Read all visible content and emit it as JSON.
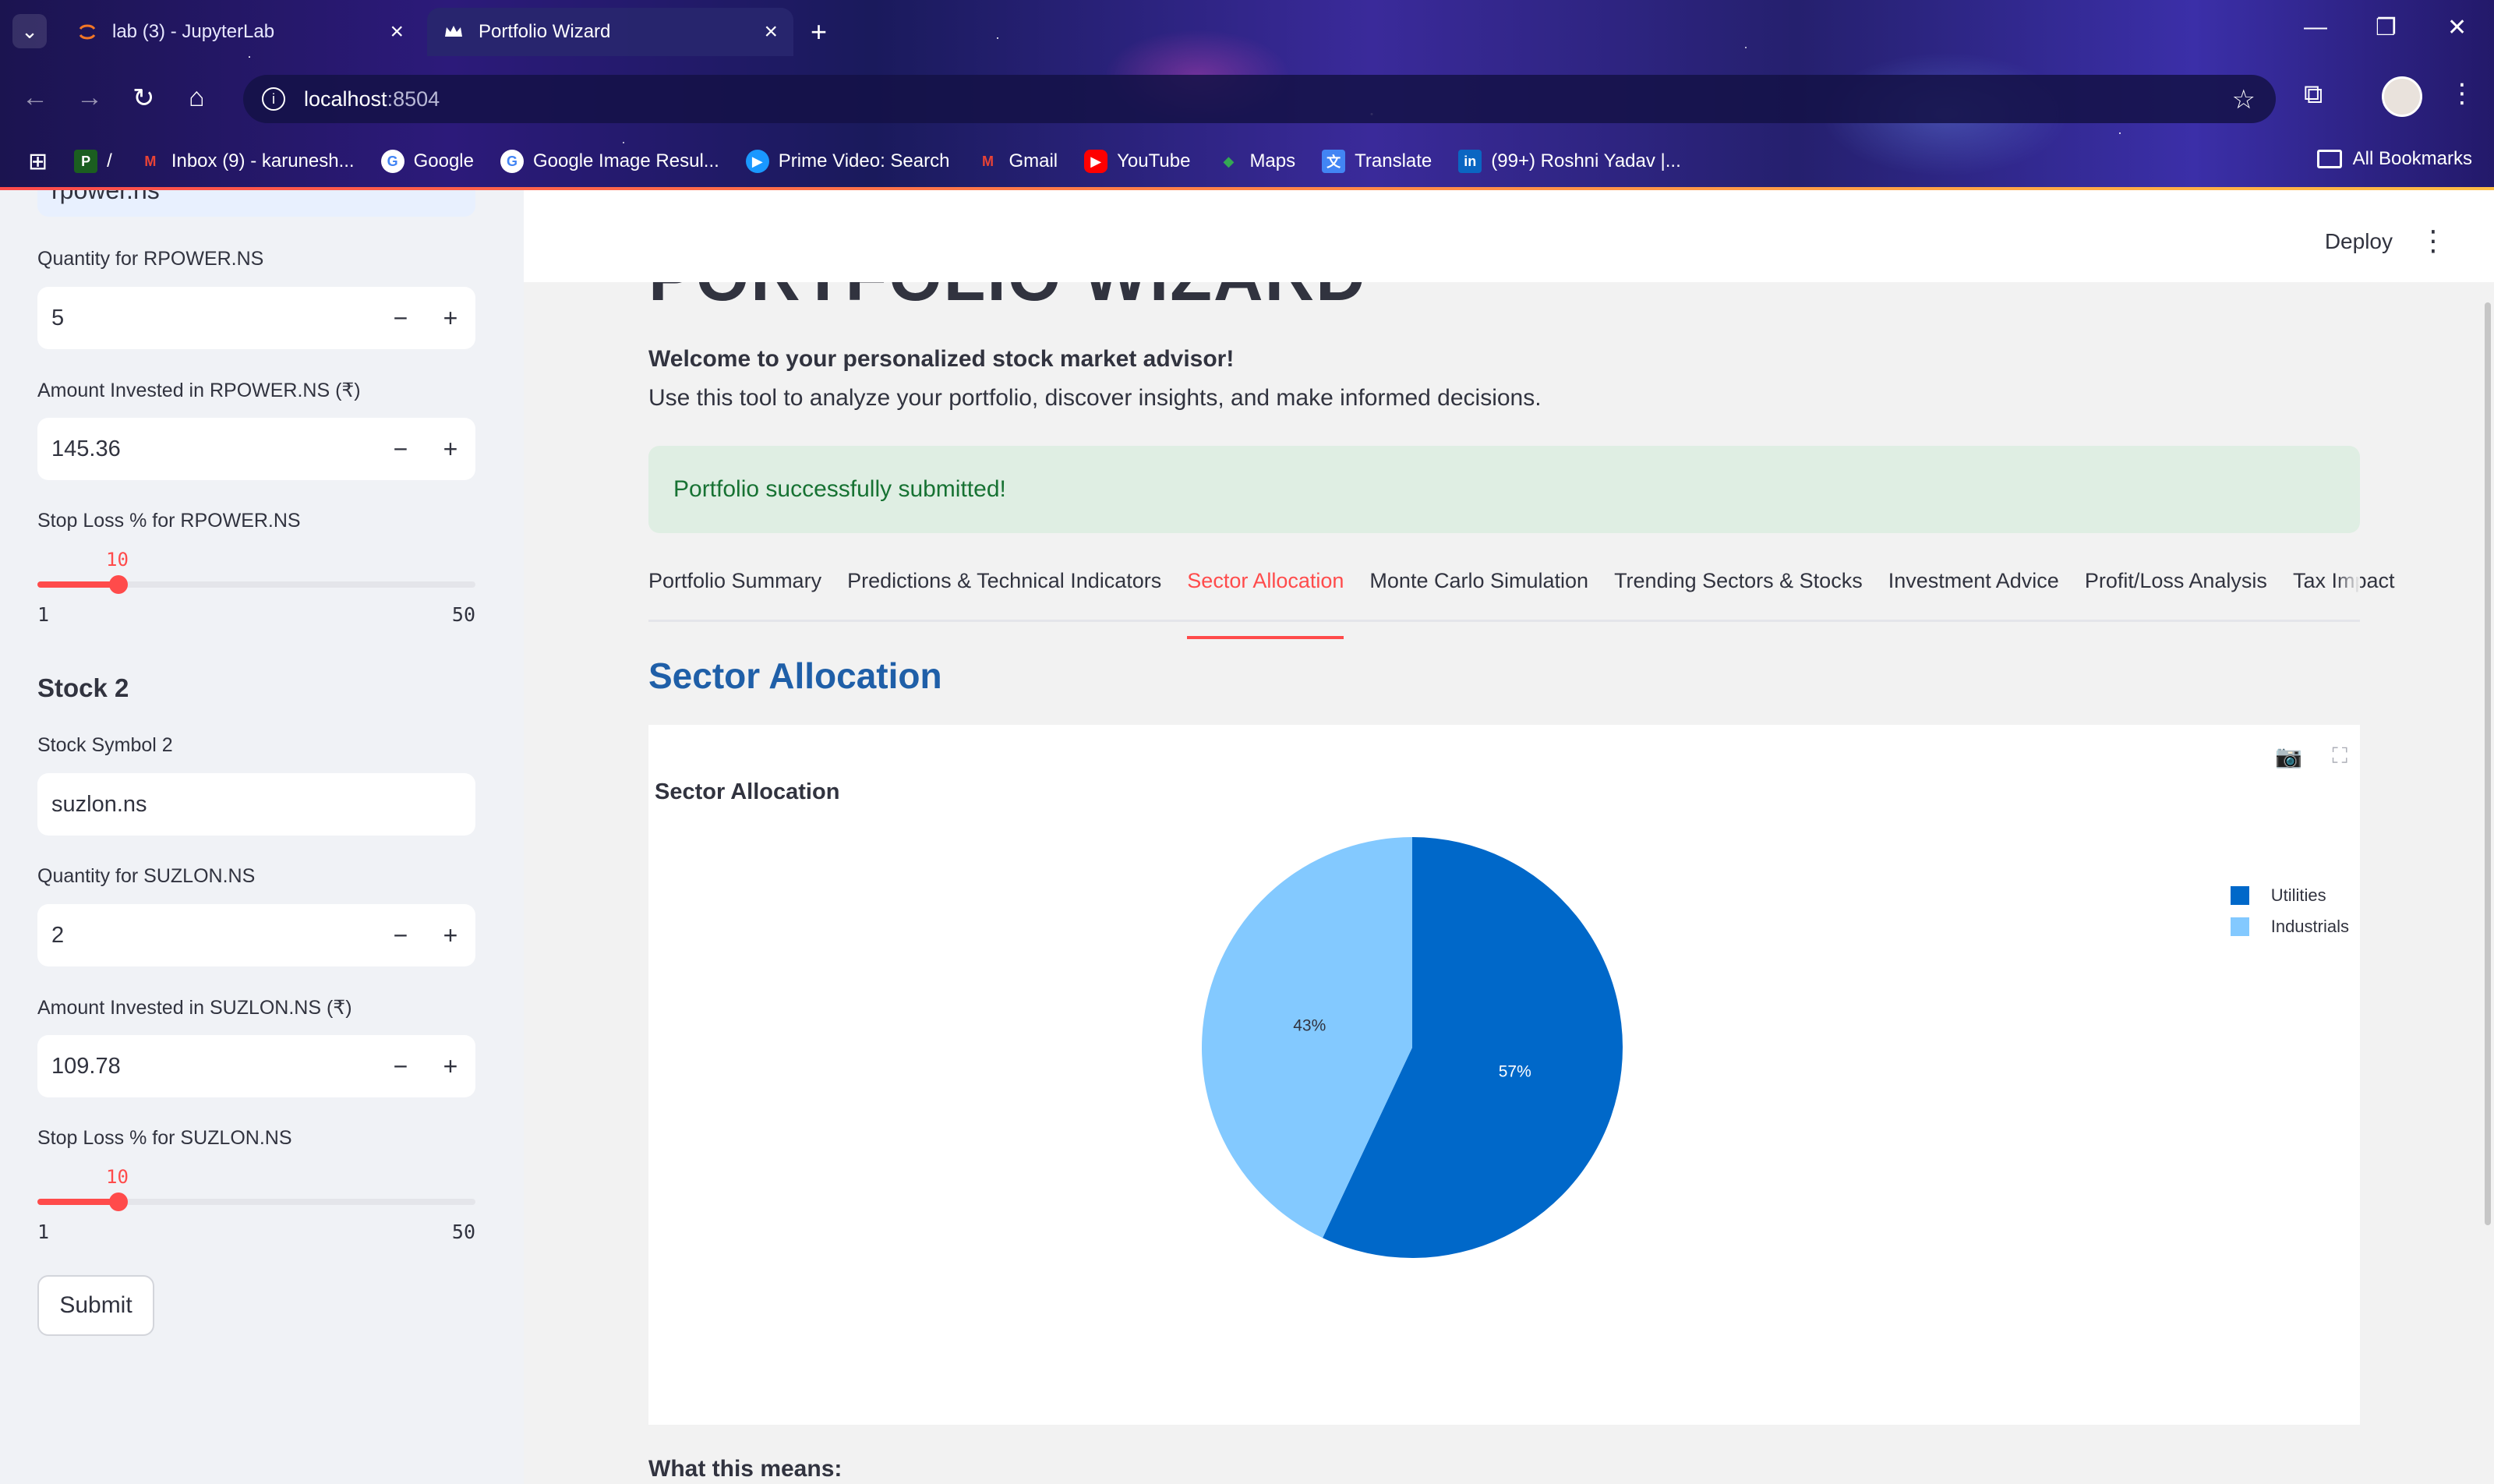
{
  "browser": {
    "tabs": [
      {
        "title": "lab (3) - JupyterLab",
        "active": false
      },
      {
        "title": "Portfolio Wizard",
        "active": true
      }
    ],
    "url_host": "localhost",
    "url_port": ":8504",
    "bookmarks": [
      {
        "label": "/",
        "icon": "bookmark-icon"
      },
      {
        "label": "Inbox (9) - karunesh...",
        "icon": "gmail-icon"
      },
      {
        "label": "Google",
        "icon": "google-icon"
      },
      {
        "label": "Google Image Resul...",
        "icon": "google-icon"
      },
      {
        "label": "Prime Video: Search",
        "icon": "prime-video-icon"
      },
      {
        "label": "Gmail",
        "icon": "gmail-icon"
      },
      {
        "label": "YouTube",
        "icon": "youtube-icon"
      },
      {
        "label": "Maps",
        "icon": "maps-icon"
      },
      {
        "label": "Translate",
        "icon": "translate-icon"
      },
      {
        "label": "(99+) Roshni Yadav |...",
        "icon": "linkedin-icon"
      }
    ],
    "all_bookmarks": "All Bookmarks"
  },
  "sidebar": {
    "cut_input_value": "rpower.ns",
    "stock1": {
      "quantity_label": "Quantity for RPOWER.NS",
      "quantity_value": "5",
      "amount_label": "Amount Invested in RPOWER.NS (₹)",
      "amount_value": "145.36",
      "stoploss_label": "Stop Loss % for RPOWER.NS",
      "stoploss_value": "10",
      "stoploss_min": "1",
      "stoploss_max": "50"
    },
    "stock2": {
      "heading": "Stock 2",
      "symbol_label": "Stock Symbol 2",
      "symbol_value": "suzlon.ns",
      "quantity_label": "Quantity for SUZLON.NS",
      "quantity_value": "2",
      "amount_label": "Amount Invested in SUZLON.NS (₹)",
      "amount_value": "109.78",
      "stoploss_label": "Stop Loss % for SUZLON.NS",
      "stoploss_value": "10",
      "stoploss_min": "1",
      "stoploss_max": "50"
    },
    "submit_label": "Submit",
    "minus": "−",
    "plus": "+"
  },
  "header": {
    "deploy_label": "Deploy"
  },
  "main": {
    "page_title": "PORTFOLIO WIZARD",
    "welcome_strong": "Welcome to your personalized stock market advisor!",
    "welcome_text": "Use this tool to analyze your portfolio, discover insights, and make informed decisions.",
    "success_message": "Portfolio successfully submitted!",
    "tabs": [
      {
        "label": "Portfolio Summary",
        "active": false
      },
      {
        "label": "Predictions & Technical Indicators",
        "active": false
      },
      {
        "label": "Sector Allocation",
        "active": true
      },
      {
        "label": "Monte Carlo Simulation",
        "active": false
      },
      {
        "label": "Trending Sectors & Stocks",
        "active": false
      },
      {
        "label": "Investment Advice",
        "active": false
      },
      {
        "label": "Profit/Loss Analysis",
        "active": false
      },
      {
        "label": "Tax Impact",
        "active": false
      }
    ],
    "section_heading": "Sector Allocation",
    "what_this_means": "What this means:"
  },
  "colors": {
    "accent": "#ff4b4b",
    "utilities": "#0068c9",
    "industrials": "#83c9ff",
    "heading_blue": "#1f5fa8"
  },
  "chart_data": {
    "type": "pie",
    "title": "Sector Allocation",
    "categories": [
      "Utilities",
      "Industrials"
    ],
    "values": [
      57,
      43
    ],
    "labels": [
      "57%",
      "43%"
    ],
    "colors": [
      "#0068c9",
      "#83c9ff"
    ],
    "legend_position": "top-right"
  }
}
